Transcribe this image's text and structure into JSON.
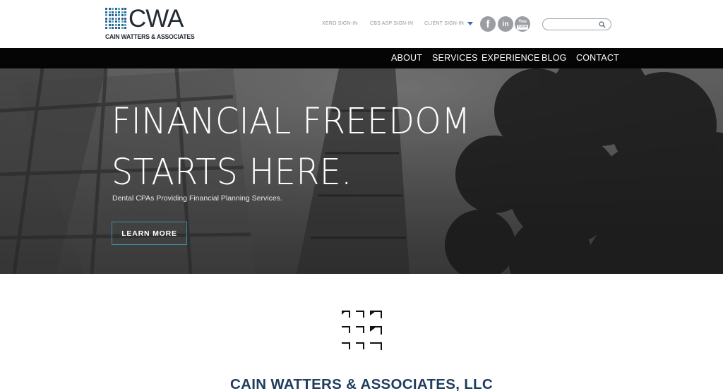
{
  "header": {
    "logo_mark": "CWA",
    "logo_subtitle": "CAIN WATTERS & ASSOCIATES",
    "signin_links": [
      "XERO SIGN-IN",
      "CBS ASP SIGN-IN",
      "CLIENT SIGN-IN"
    ],
    "social": {
      "facebook_glyph": "f",
      "linkedin_glyph": "in",
      "youtube_glyph_top": "You",
      "youtube_glyph_bottom": "Tube"
    },
    "search": {
      "value": "",
      "placeholder": ""
    }
  },
  "nav": {
    "items": [
      "ABOUT",
      "SERVICES",
      "EXPERIENCE",
      "BLOG",
      "CONTACT"
    ]
  },
  "hero": {
    "title_line_1": "FINANCIAL FREEDOM",
    "title_line_2": "STARTS HERE.",
    "subtitle": "Dental CPAs Providing Financial Planning Services.",
    "cta_label": "LEARN MORE"
  },
  "intro": {
    "company_name": "CAIN WATTERS & ASSOCIATES, LLC"
  },
  "colors": {
    "nav_background": "#050505",
    "brand_navy": "#1f3e5e",
    "cta_border": "#3f8ea0",
    "logo_dots_dark": "#2f5d8a",
    "logo_dots_light": "#4aa9c6",
    "social_icon_bg": "#9a9ea3"
  },
  "icons": [
    "cwa-logo-dots-icon",
    "dropdown-caret-icon",
    "facebook-icon",
    "linkedin-icon",
    "youtube-icon",
    "search-icon",
    "brand-corner-grid-icon"
  ]
}
